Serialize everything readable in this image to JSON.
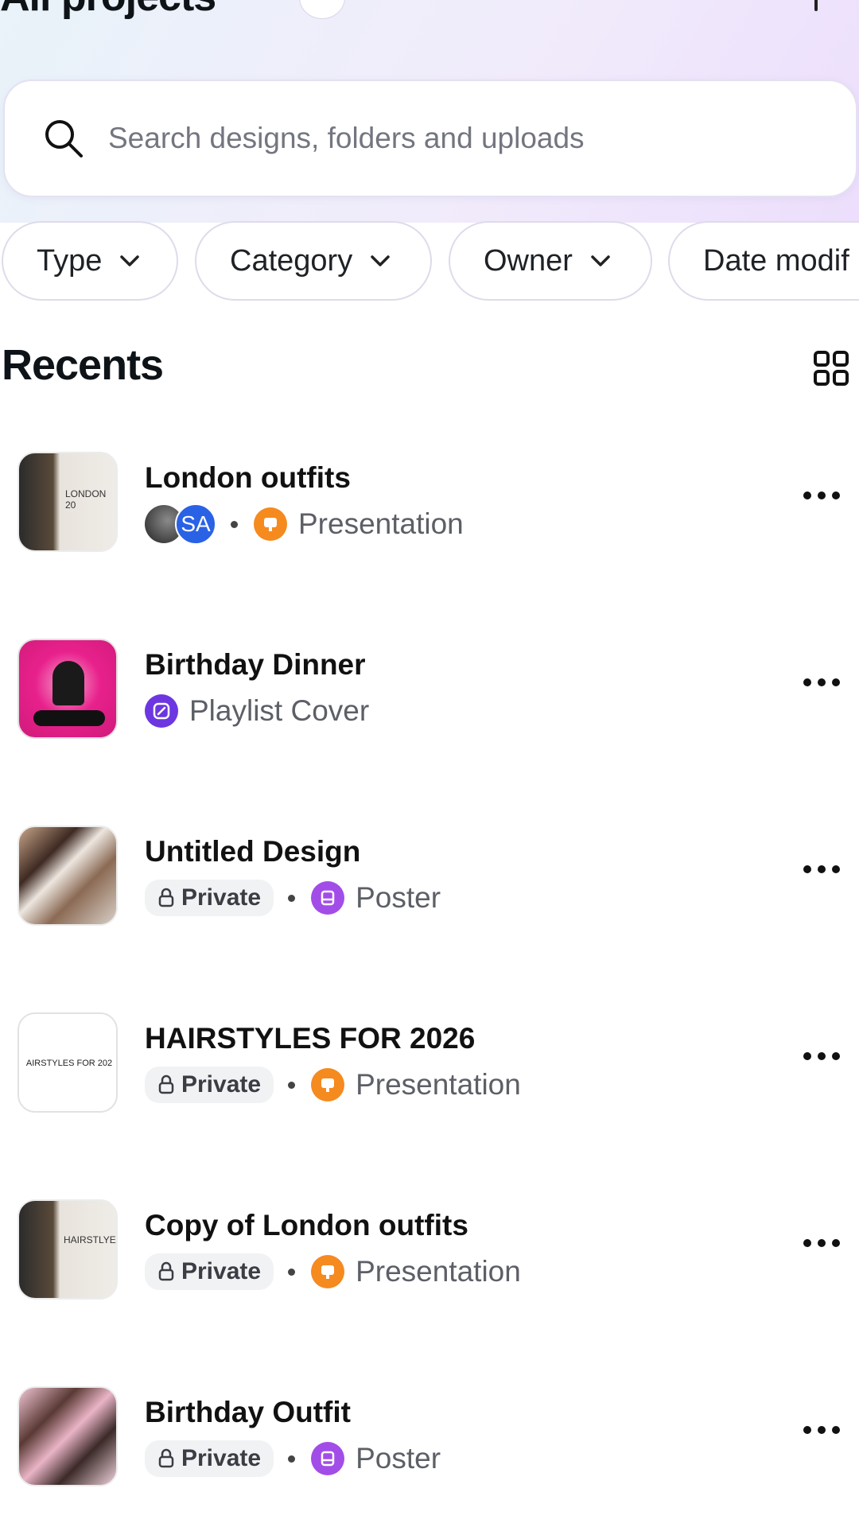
{
  "header": {
    "title": "All projects"
  },
  "search": {
    "placeholder": "Search designs, folders and uploads"
  },
  "filters": [
    {
      "label": "Type"
    },
    {
      "label": "Category"
    },
    {
      "label": "Owner"
    },
    {
      "label": "Date modif"
    }
  ],
  "recents": {
    "title": "Recents",
    "items": [
      {
        "title": "London outfits",
        "privacy": "",
        "type": "Presentation",
        "type_color": "#f58a1f",
        "avatar_initials": "SA",
        "thumb_text": "LONDON 20"
      },
      {
        "title": "Birthday Dinner",
        "privacy": "",
        "type": "Playlist Cover",
        "type_color": "#6c37e0",
        "thumb_text": ""
      },
      {
        "title": "Untitled Design",
        "privacy": "Private",
        "type": "Poster",
        "type_color": "#a24de8",
        "thumb_text": ""
      },
      {
        "title": "HAIRSTYLES FOR 2026",
        "privacy": "Private",
        "type": "Presentation",
        "type_color": "#f58a1f",
        "thumb_text": "AIRSTYLES FOR 202"
      },
      {
        "title": "Copy of London outfits",
        "privacy": "Private",
        "type": "Presentation",
        "type_color": "#f58a1f",
        "thumb_text": "HAIRSTLYE"
      },
      {
        "title": "Birthday Outfit",
        "privacy": "Private",
        "type": "Poster",
        "type_color": "#a24de8",
        "thumb_text": ""
      }
    ]
  },
  "colors": {
    "accent_purple": "#7d2ae8",
    "presentation": "#f58a1f",
    "poster": "#a24de8",
    "playlist": "#6c37e0"
  }
}
